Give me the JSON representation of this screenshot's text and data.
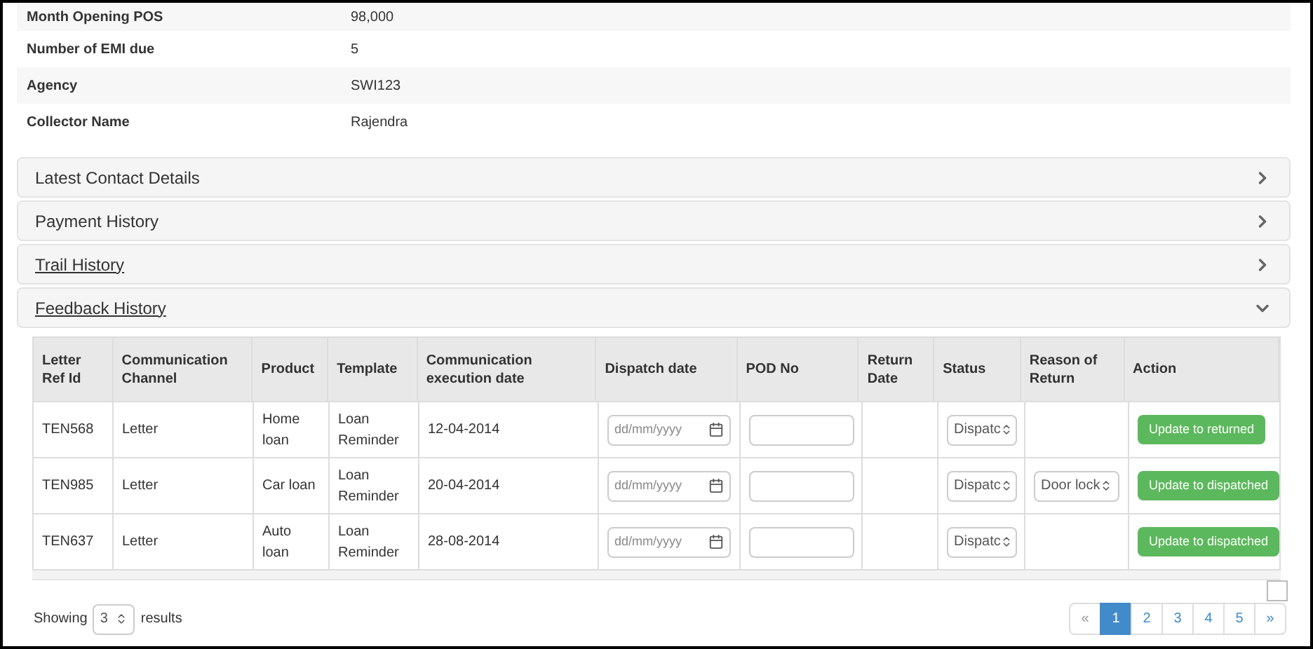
{
  "details": [
    {
      "label": "Month Opening POS",
      "value": "98,000"
    },
    {
      "label": "Number of EMI due",
      "value": "5"
    },
    {
      "label": "Agency",
      "value": "SWI123"
    },
    {
      "label": "Collector Name",
      "value": "Rajendra"
    }
  ],
  "panels": [
    {
      "title": "Latest Contact Details",
      "expanded": false,
      "link": false
    },
    {
      "title": "Payment History",
      "expanded": false,
      "link": false
    },
    {
      "title": "Trail History",
      "expanded": false,
      "link": true
    },
    {
      "title": "Feedback History",
      "expanded": true,
      "link": true
    }
  ],
  "table": {
    "columns": [
      "Letter Ref Id",
      "Communication Channel",
      "Product",
      "Template",
      "Communication execution date",
      "Dispatch date",
      "POD No",
      "Return Date",
      "Status",
      "Reason of Return",
      "Action"
    ],
    "rows": [
      {
        "ref": "TEN568",
        "channel": "Letter",
        "product": "Home loan",
        "template": "Loan Reminder",
        "exec_date": "12-04-2014",
        "dispatch_placeholder": "dd/mm/yyyy",
        "status": "Dispatc",
        "reason": "",
        "action": "Update to returned"
      },
      {
        "ref": "TEN985",
        "channel": "Letter",
        "product": "Car loan",
        "template": "Loan Reminder",
        "exec_date": "20-04-2014",
        "dispatch_placeholder": "dd/mm/yyyy",
        "status": "Dispatc",
        "reason": "Door lock",
        "action": "Update to dispatched"
      },
      {
        "ref": "TEN637",
        "channel": "Letter",
        "product": "Auto loan",
        "template": "Loan Reminder",
        "exec_date": "28-08-2014",
        "dispatch_placeholder": "dd/mm/yyyy",
        "status": "Dispatc",
        "reason": "",
        "action": "Update to dispatched"
      }
    ]
  },
  "footer": {
    "showing": "Showing",
    "count": "3",
    "results": "results"
  },
  "pagination": {
    "prev": "«",
    "next": "»",
    "pages": [
      {
        "label": "1",
        "selected": true
      },
      {
        "label": "2",
        "selected": false
      },
      {
        "label": "3",
        "selected": false
      },
      {
        "label": "4",
        "selected": false
      },
      {
        "label": "5",
        "selected": false
      }
    ]
  }
}
